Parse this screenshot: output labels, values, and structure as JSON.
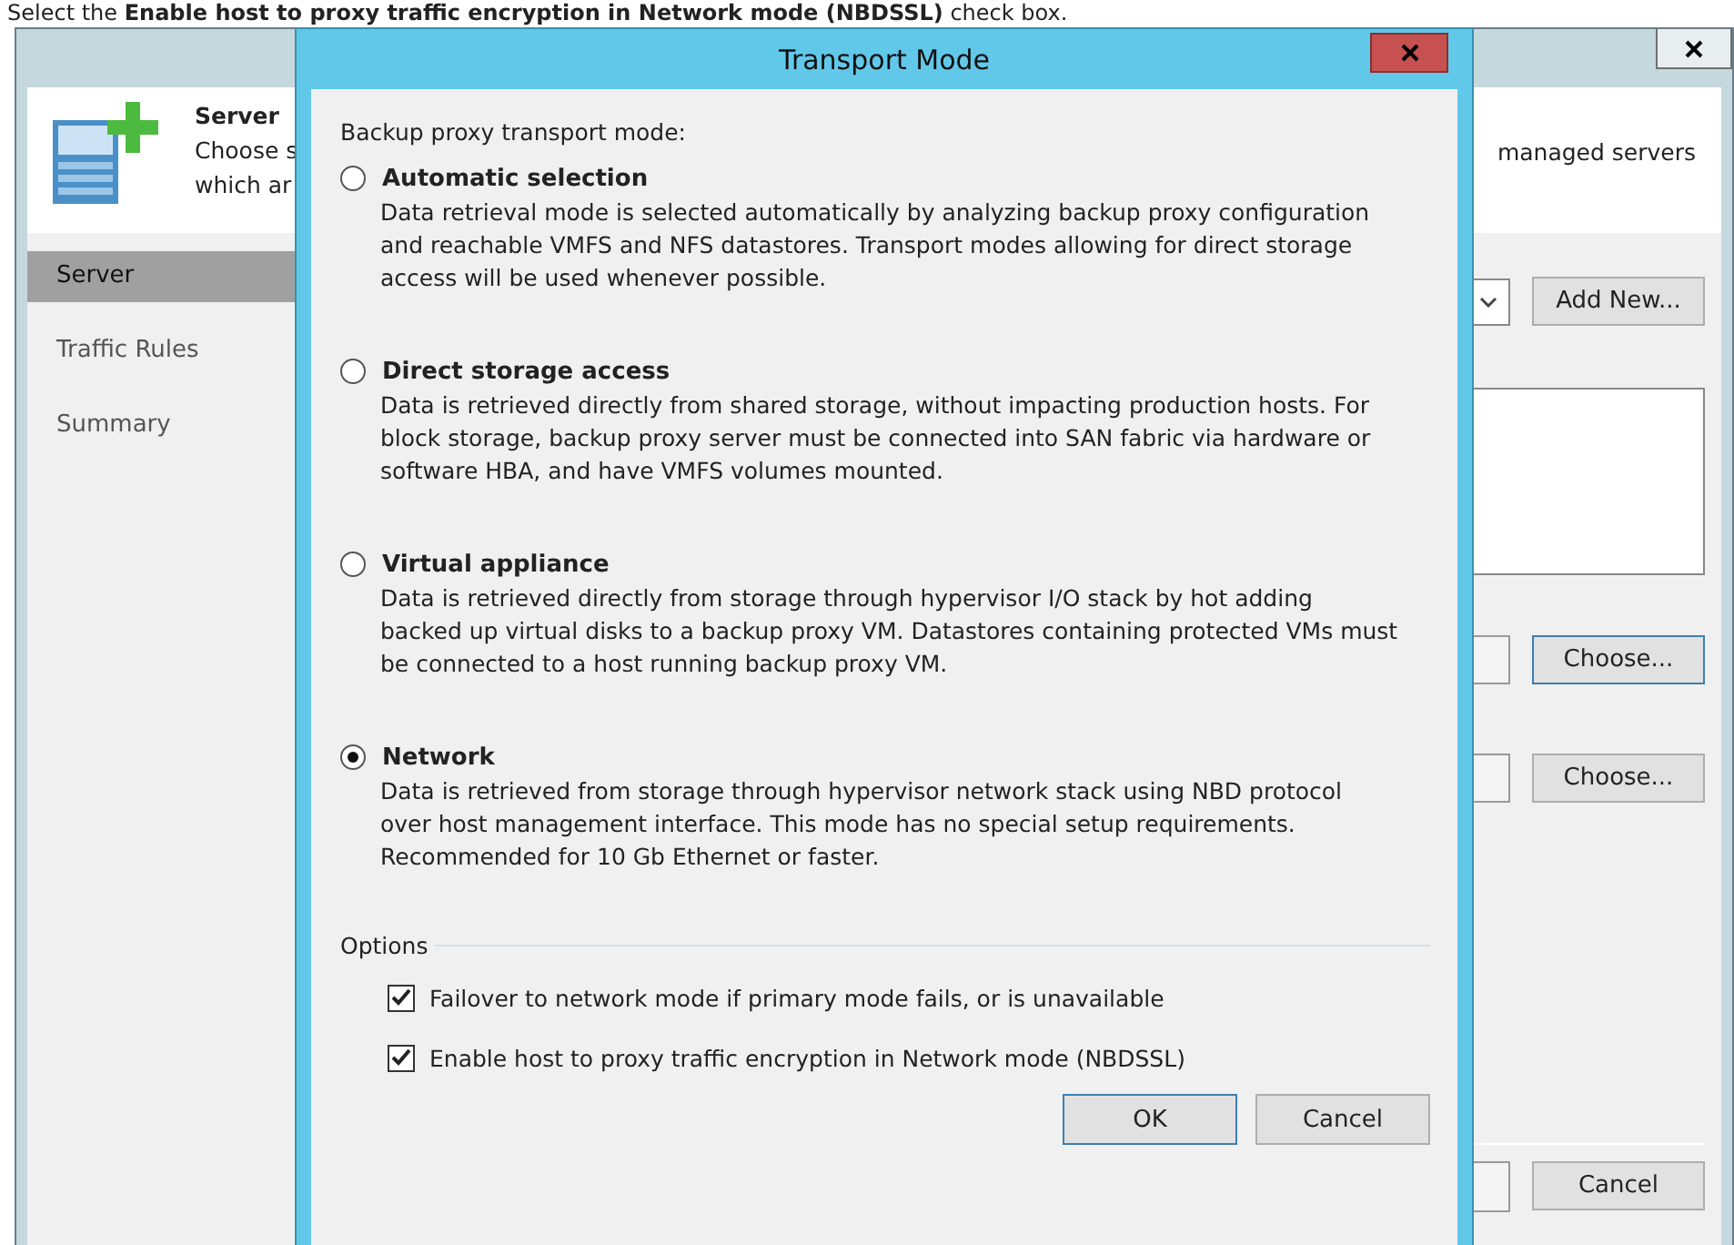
{
  "caption": "Select the **Enable host to proxy traffic encryption in Network mode (NBDSSL)** check box.",
  "header": {
    "title": "Server",
    "description_lines": [
      "Choose s",
      "which ar"
    ],
    "right_text": "managed servers"
  },
  "sidebar": {
    "items": [
      {
        "label": "Server",
        "selected": true
      },
      {
        "label": "Traffic Rules",
        "selected": false
      },
      {
        "label": "Summary",
        "selected": false
      }
    ]
  },
  "form": {
    "add_button": "Add New...",
    "choose_buttons": [
      "Choose...",
      "Choose..."
    ],
    "cancel_button": "Cancel"
  },
  "dialog": {
    "title": "Transport Mode",
    "prompt": "Backup proxy transport mode:",
    "modes": [
      {
        "label": "Automatic selection",
        "selected": false,
        "description": "Data retrieval mode is selected automatically by analyzing backup proxy configuration and reachable VMFS and NFS datastores. Transport modes allowing for direct storage access will be used whenever possible."
      },
      {
        "label": "Direct storage access",
        "selected": false,
        "description": "Data is retrieved directly from shared storage, without impacting production hosts. For block storage, backup proxy server must be connected into SAN fabric via hardware or software HBA, and have VMFS volumes mounted."
      },
      {
        "label": "Virtual appliance",
        "selected": false,
        "description": "Data is retrieved directly from storage through hypervisor I/O stack by hot adding backed up virtual disks to a backup proxy VM. Datastores containing protected VMs must be connected to a host running backup proxy VM."
      },
      {
        "label": "Network",
        "selected": true,
        "description": "Data is retrieved from storage through hypervisor network stack using NBD protocol over host management interface. This mode has no special setup requirements. Recommended for 10 Gb Ethernet or faster."
      }
    ],
    "options_label": "Options",
    "options": [
      {
        "label": "Failover to network mode if primary mode fails, or is unavailable",
        "checked": true
      },
      {
        "label": "Enable host to proxy traffic encryption in Network mode (NBDSSL)",
        "checked": true
      }
    ],
    "buttons": [
      {
        "label": "OK",
        "default": true
      },
      {
        "label": "Cancel",
        "default": false
      }
    ]
  }
}
